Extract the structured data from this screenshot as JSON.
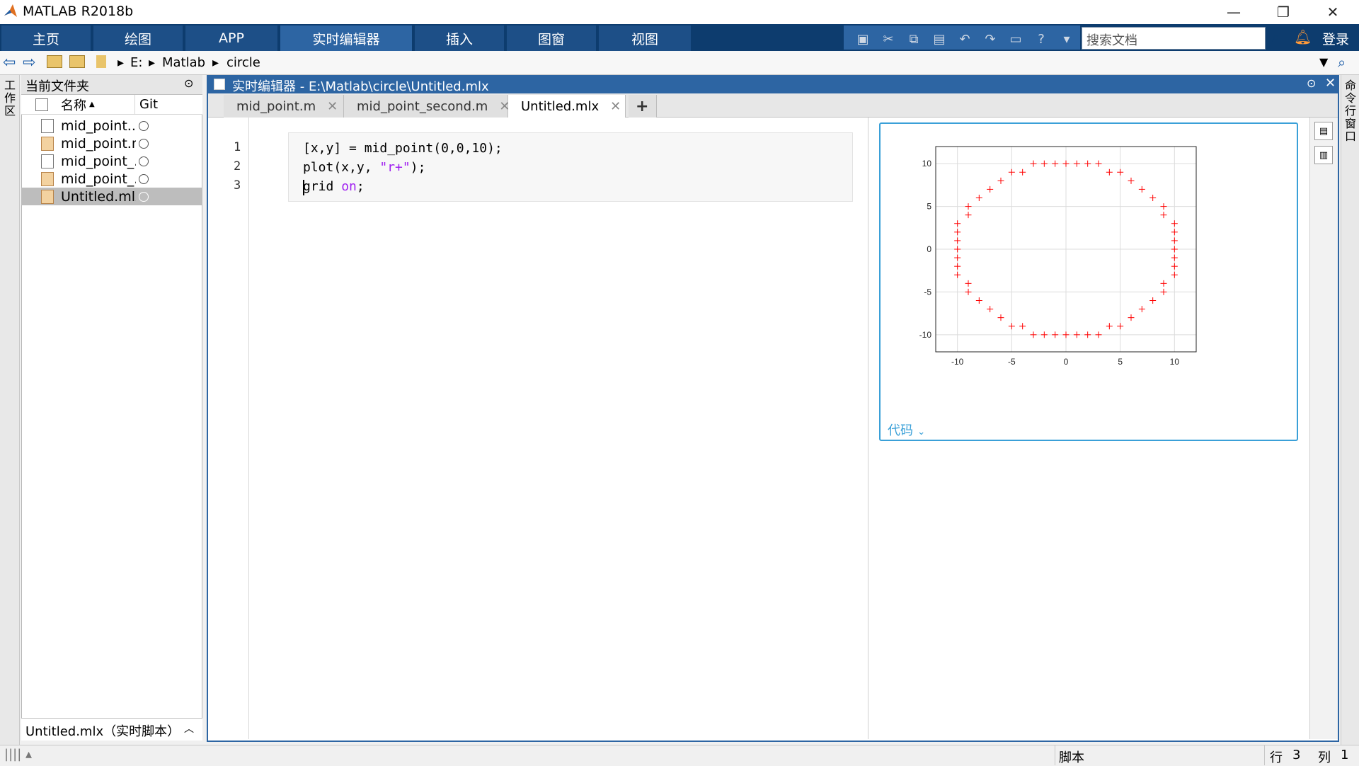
{
  "window": {
    "title": "MATLAB R2018b"
  },
  "ribbon": {
    "tabs": [
      "主页",
      "绘图",
      "APP",
      "实时编辑器",
      "插入",
      "图窗",
      "视图"
    ],
    "search_placeholder": "搜索文档",
    "login": "登录"
  },
  "address": {
    "parts": [
      "E:",
      "Matlab",
      "circle"
    ]
  },
  "left_strip": {
    "label": "工作区"
  },
  "right_strip": {
    "label": "命令行窗口"
  },
  "files": {
    "header": "当前文件夹",
    "col_name": "名称",
    "col_git": "Git",
    "items": [
      {
        "name": "mid_point....",
        "type": "m"
      },
      {
        "name": "mid_point.m",
        "type": "mlx"
      },
      {
        "name": "mid_point_...",
        "type": "m"
      },
      {
        "name": "mid_point_...",
        "type": "mlx"
      },
      {
        "name": "Untitled.mlx",
        "type": "mlx"
      }
    ],
    "details": "Untitled.mlx（实时脚本）"
  },
  "editor": {
    "title": "实时编辑器 - E:\\Matlab\\circle\\Untitled.mlx",
    "tabs": [
      "mid_point.m",
      "mid_point_second.m",
      "Untitled.mlx"
    ],
    "add_tab": "+",
    "line_numbers": [
      "1",
      "2",
      "3"
    ],
    "code": {
      "l1": "[x,y] = mid_point(0,0,10);",
      "l2_a": "plot(x,y, ",
      "l2_b": "\"r+\"",
      "l2_c": ");",
      "l3_a": "grid ",
      "l3_b": "on",
      "l3_c": ";"
    },
    "output_code_link": "代码"
  },
  "chart_data": {
    "type": "scatter",
    "marker": "r+",
    "color": "#ff0000",
    "grid": true,
    "xlim": [
      -12,
      12
    ],
    "ylim": [
      -12,
      12
    ],
    "xticks": [
      "-10",
      "-5",
      "0",
      "5",
      "10"
    ],
    "yticks": [
      "10",
      "5",
      "0",
      "-5",
      "-10"
    ],
    "points": [
      [
        0,
        10
      ],
      [
        1,
        10
      ],
      [
        2,
        10
      ],
      [
        3,
        10
      ],
      [
        4,
        9
      ],
      [
        5,
        9
      ],
      [
        6,
        8
      ],
      [
        7,
        7
      ],
      [
        8,
        6
      ],
      [
        9,
        5
      ],
      [
        9,
        4
      ],
      [
        10,
        3
      ],
      [
        10,
        2
      ],
      [
        10,
        1
      ],
      [
        10,
        0
      ],
      [
        0,
        -10
      ],
      [
        1,
        -10
      ],
      [
        2,
        -10
      ],
      [
        3,
        -10
      ],
      [
        4,
        -9
      ],
      [
        5,
        -9
      ],
      [
        6,
        -8
      ],
      [
        7,
        -7
      ],
      [
        8,
        -6
      ],
      [
        9,
        -5
      ],
      [
        9,
        -4
      ],
      [
        10,
        -3
      ],
      [
        10,
        -2
      ],
      [
        10,
        -1
      ],
      [
        -1,
        10
      ],
      [
        -2,
        10
      ],
      [
        -3,
        10
      ],
      [
        -4,
        9
      ],
      [
        -5,
        9
      ],
      [
        -6,
        8
      ],
      [
        -7,
        7
      ],
      [
        -8,
        6
      ],
      [
        -9,
        5
      ],
      [
        -9,
        4
      ],
      [
        -10,
        3
      ],
      [
        -10,
        2
      ],
      [
        -10,
        1
      ],
      [
        -10,
        0
      ],
      [
        -1,
        -10
      ],
      [
        -2,
        -10
      ],
      [
        -3,
        -10
      ],
      [
        -4,
        -9
      ],
      [
        -5,
        -9
      ],
      [
        -6,
        -8
      ],
      [
        -7,
        -7
      ],
      [
        -8,
        -6
      ],
      [
        -9,
        -5
      ],
      [
        -9,
        -4
      ],
      [
        -10,
        -3
      ],
      [
        -10,
        -2
      ],
      [
        -10,
        -1
      ]
    ]
  },
  "status": {
    "type": "脚本",
    "row_label": "行",
    "row": "3",
    "col_label": "列",
    "col": "1"
  }
}
